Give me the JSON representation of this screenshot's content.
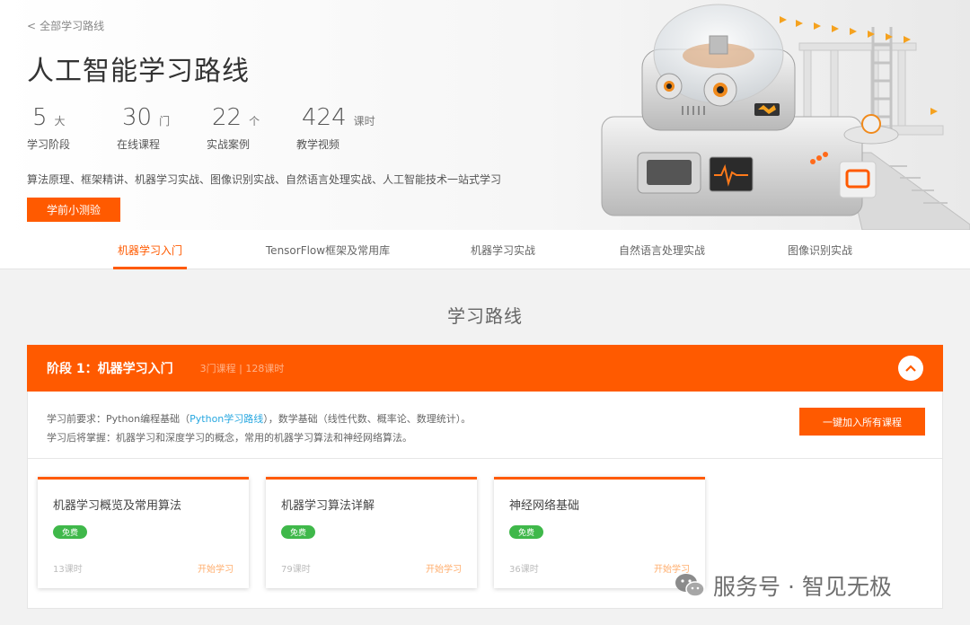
{
  "hero": {
    "back_label": "全部学习路线",
    "title": "人工智能学习路线",
    "stats": [
      {
        "num": "5",
        "unit": "大",
        "label": "学习阶段"
      },
      {
        "num": "30",
        "unit": "门",
        "label": "在线课程"
      },
      {
        "num": "22",
        "unit": "个",
        "label": "实战案例"
      },
      {
        "num": "424",
        "unit": "课时",
        "label": "教学视频"
      }
    ],
    "description": "算法原理、框架精讲、机器学习实战、图像识别实战、自然语言处理实战、人工智能技术一站式学习",
    "quiz_button": "学前小测验"
  },
  "tabs": [
    {
      "label": "机器学习入门",
      "active": true
    },
    {
      "label": "TensorFlow框架及常用库",
      "active": false
    },
    {
      "label": "机器学习实战",
      "active": false
    },
    {
      "label": "自然语言处理实战",
      "active": false
    },
    {
      "label": "图像识别实战",
      "active": false
    }
  ],
  "section_title": "学习路线",
  "stage": {
    "name": "阶段 1：机器学习入门",
    "meta": "3门课程 | 128课时",
    "req_prefix": "学习前要求：Python编程基础（",
    "req_link": "Python学习路线",
    "req_suffix": "），数学基础（线性代数、概率论、数理统计）。",
    "outcome": "学习后将掌握：机器学习和深度学习的概念，常用的机器学习算法和神经网络算法。",
    "join_button": "一键加入所有课程",
    "courses": [
      {
        "name": "机器学习概览及常用算法",
        "badge": "免费",
        "hours": "13课时",
        "action": "开始学习"
      },
      {
        "name": "机器学习算法详解",
        "badge": "免费",
        "hours": "79课时",
        "action": "开始学习"
      },
      {
        "name": "神经网络基础",
        "badge": "免费",
        "hours": "36课时",
        "action": "开始学习"
      }
    ]
  },
  "watermark": "服务号 · 智见无极",
  "colors": {
    "accent": "#ff5a00",
    "free_badge": "#3fb84a",
    "link": "#29a8e0"
  }
}
